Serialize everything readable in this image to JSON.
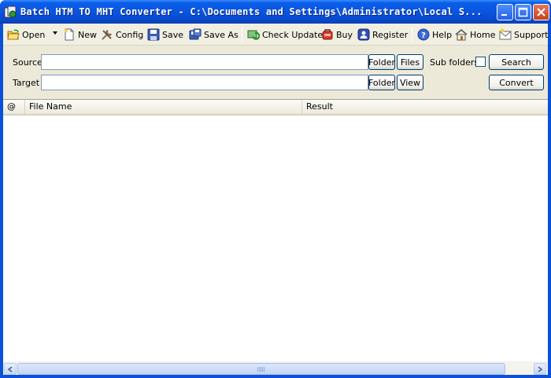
{
  "window": {
    "title": "Batch HTM TO MHT Converter - C:\\Documents and Settings\\Administrator\\Local S..."
  },
  "toolbar": {
    "open": "Open",
    "new": "New",
    "config": "Config",
    "save": "Save",
    "save_as": "Save As",
    "check_update": "Check Update",
    "buy": "Buy",
    "register": "Register",
    "help": "Help",
    "home": "Home",
    "support": "Support"
  },
  "panel": {
    "source_label": "Source",
    "target_label": "Target",
    "source_value": "",
    "target_value": "",
    "folder_button": "Folder",
    "files_button": "Files",
    "view_button": "View",
    "subfolders_label": "Sub folders",
    "subfolders_checked": false,
    "search_button": "Search",
    "convert_button": "Convert"
  },
  "list": {
    "columns": [
      "@",
      "File Name",
      "Result"
    ],
    "rows": []
  },
  "colors": {
    "titlebar": "#0a55e0",
    "window_bg": "#ece9d8",
    "button_border": "#003c74"
  }
}
